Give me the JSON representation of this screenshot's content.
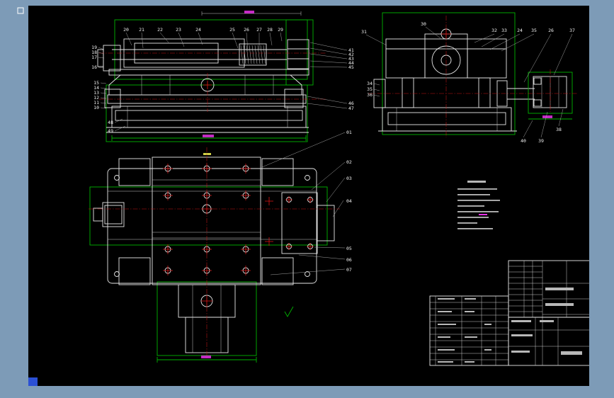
{
  "workspace": {
    "background_color": "#7d9bb7",
    "canvas_color": "#000000",
    "corner_swatch_color": "#2b50d4"
  },
  "colors": {
    "line": "#e8e8e8",
    "envelope_green": "#00b400",
    "centerline_red": "#c81414",
    "hatch_magenta": "#e632e6",
    "hatch_yellow": "#c8c85a"
  },
  "drawing": {
    "side_section": {
      "top_callouts": [
        "20",
        "21",
        "22",
        "23",
        "24",
        "25",
        "26",
        "27",
        "28",
        "29"
      ],
      "right_callouts": [
        "41",
        "42",
        "43",
        "44",
        "45"
      ],
      "right_lower_callouts": [
        "46",
        "47"
      ],
      "left_upper_callouts": [
        "19",
        "18",
        "17",
        "16"
      ],
      "left_lower_callouts": [
        "15",
        "14",
        "13",
        "12",
        "11",
        "10"
      ],
      "bottom_left_callouts": [
        "48",
        "49"
      ]
    },
    "end_section": {
      "top_left_callout": "31",
      "top_callout": "30",
      "top_right_callouts": [
        "32",
        "33",
        "24",
        "35",
        "26",
        "37"
      ],
      "left_callouts": [
        "34",
        "35",
        "36"
      ],
      "bottom_callouts": [
        "40",
        "39",
        "38"
      ]
    },
    "plan_view": {
      "right_callouts": [
        "01",
        "02",
        "03",
        "04",
        "05",
        "06",
        "07"
      ]
    }
  }
}
